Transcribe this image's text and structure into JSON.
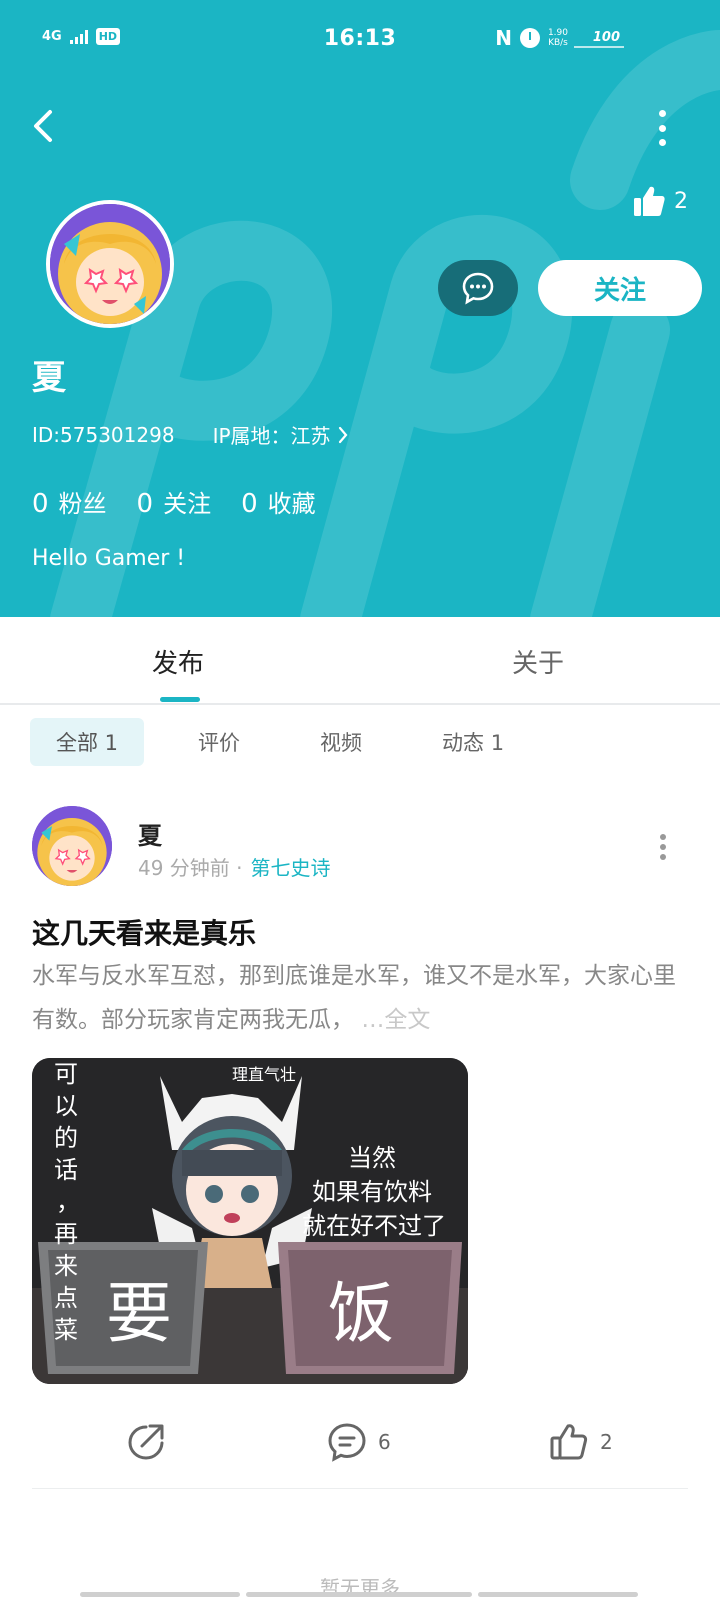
{
  "status_bar": {
    "network": "4G",
    "hd": "HD",
    "time": "16:13",
    "nfc": "N",
    "speed_value": "1.90",
    "speed_unit": "KB/s",
    "battery": "100"
  },
  "profile": {
    "likes_count": "2",
    "message_icon": "chat-bubble-icon",
    "follow_label": "关注",
    "username": "夏",
    "id_text": "ID:575301298",
    "ip_text": "IP属地：江苏",
    "stats": [
      {
        "count": "0",
        "label": "粉丝"
      },
      {
        "count": "0",
        "label": "关注"
      },
      {
        "count": "0",
        "label": "收藏"
      }
    ],
    "bio": "Hello Gamer !"
  },
  "tabs": [
    {
      "label": "发布",
      "active": true
    },
    {
      "label": "关于",
      "active": false
    }
  ],
  "filters": [
    {
      "label": "全部 1",
      "active": true
    },
    {
      "label": "评价",
      "active": false
    },
    {
      "label": "视频",
      "active": false
    },
    {
      "label": "动态 1",
      "active": false
    }
  ],
  "post": {
    "author": "夏",
    "time_ago": "49 分钟前 ·",
    "game": "第七史诗",
    "title": "这几天看来是真乐",
    "body": "水军与反水军互怼，那到底谁是水军，谁又不是水军，大家心里有数。部分玩家肯定两我无瓜，",
    "more": "…全文",
    "image_text": {
      "left_vertical": [
        "可",
        "以",
        "的",
        "话",
        "，",
        "再",
        "来",
        "点",
        "菜"
      ],
      "top_caption": "理直气壮",
      "right_caption": [
        "当然",
        "如果有饮料",
        "就在好不过了"
      ],
      "box_left": "要",
      "box_right": "饭"
    },
    "comments": "6",
    "likes": "2"
  },
  "footer": {
    "no_more": "暂无更多"
  },
  "colors": {
    "accent": "#1bb5c4",
    "dark_teal": "#176d78"
  }
}
